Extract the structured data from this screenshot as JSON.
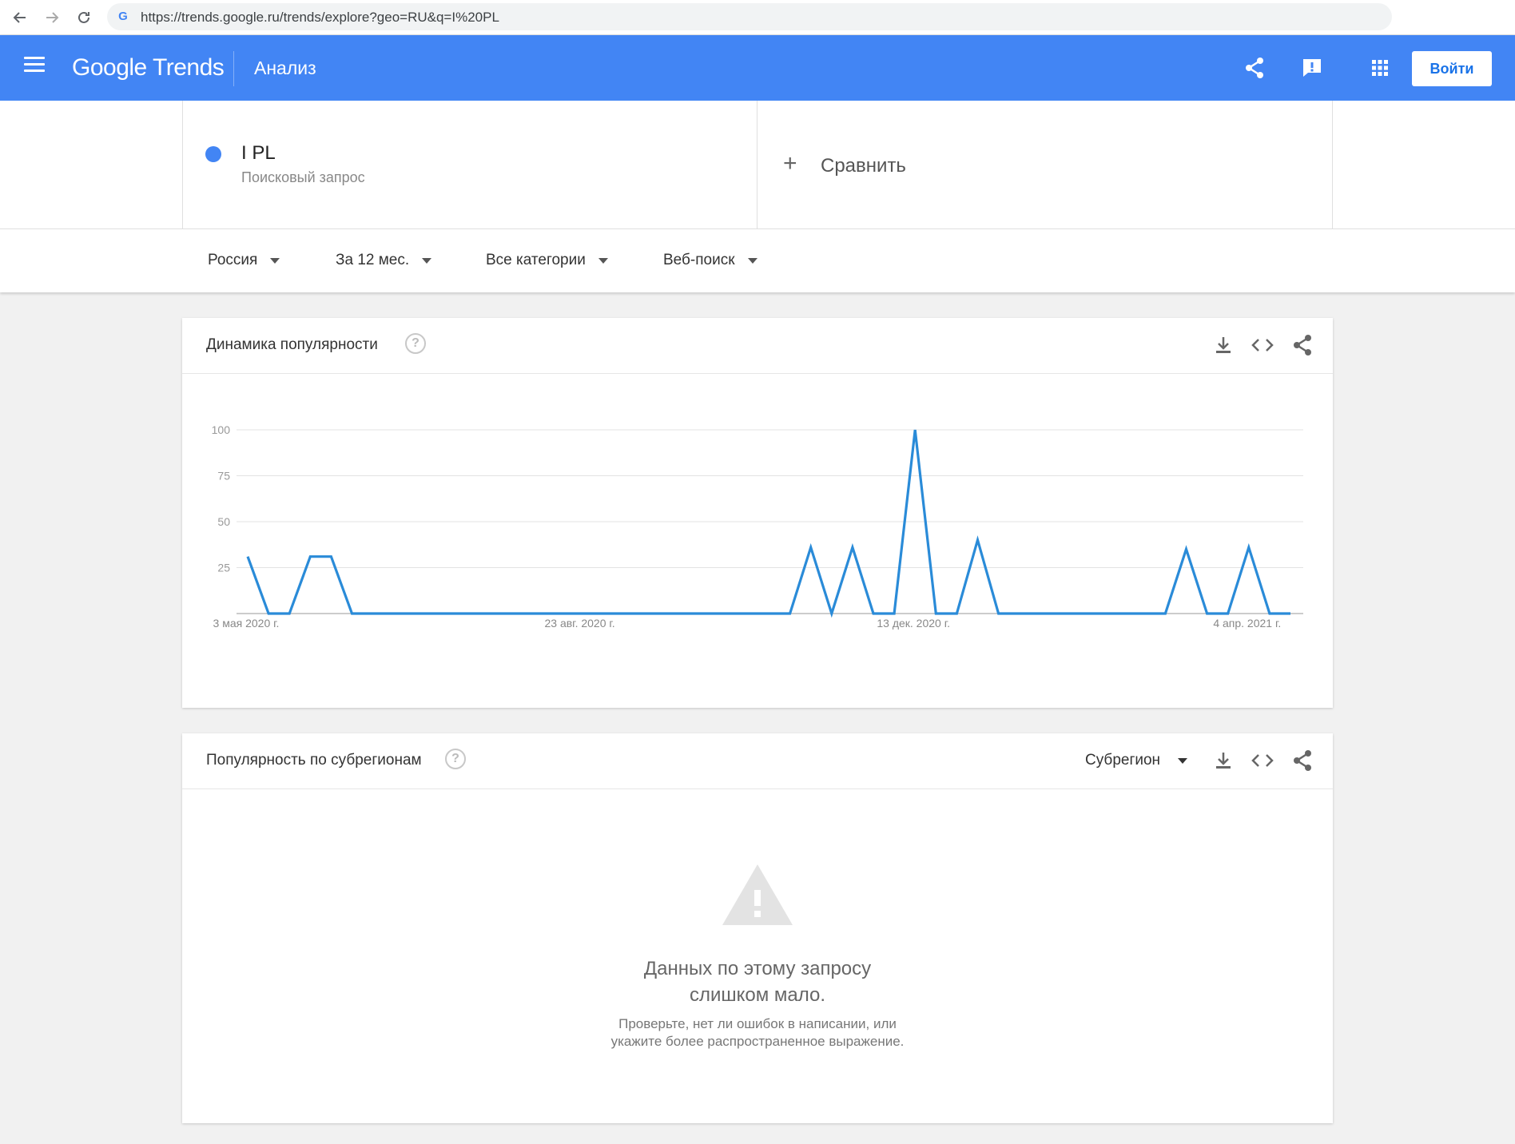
{
  "browser": {
    "url": "https://trends.google.ru/trends/explore?geo=RU&q=I%20PL"
  },
  "header": {
    "logo": "Google Trends",
    "title": "Анализ",
    "signin_label": "Войти",
    "accent_color": "#4285f4"
  },
  "term": {
    "name": "I PL",
    "type": "Поисковый запрос",
    "color": "#4285f4"
  },
  "compare": {
    "label": "Сравнить"
  },
  "filters": {
    "region": "Россия",
    "period": "За 12 мес.",
    "category": "Все категории",
    "search_type": "Веб-поиск"
  },
  "interest_over_time": {
    "title": "Динамика популярности",
    "help": "?"
  },
  "subregions": {
    "title": "Популярность по субрегионам",
    "help": "?",
    "resolution": "Субрегион",
    "empty_title_line1": "Данных по этому запросу",
    "empty_title_line2": "слишком мало.",
    "empty_sub_line1": "Проверьте, нет ли ошибок в написании, или",
    "empty_sub_line2": "укажите более распространенное выражение."
  },
  "chart_data": {
    "type": "line",
    "ylim": [
      0,
      100
    ],
    "y_ticks": [
      25,
      50,
      75,
      100
    ],
    "x_tick_labels": [
      "3 мая 2020 г.",
      "23 авг. 2020 г.",
      "13 дек. 2020 г.",
      "4 апр. 2021 г."
    ],
    "x_tick_weeks": [
      0,
      16,
      32,
      48
    ],
    "grid": true,
    "series": [
      {
        "color": "#2a8bd8",
        "weeks": [
          0,
          1,
          2,
          3,
          4,
          5,
          26,
          27,
          28,
          29,
          30,
          31,
          32,
          33,
          34,
          35,
          36,
          44,
          45,
          46,
          47,
          48,
          49,
          50
        ],
        "values": [
          31,
          0,
          0,
          31,
          31,
          0,
          0,
          36,
          0,
          36,
          0,
          0,
          100,
          0,
          0,
          40,
          0,
          0,
          35,
          0,
          0,
          36,
          0,
          0
        ]
      }
    ]
  }
}
